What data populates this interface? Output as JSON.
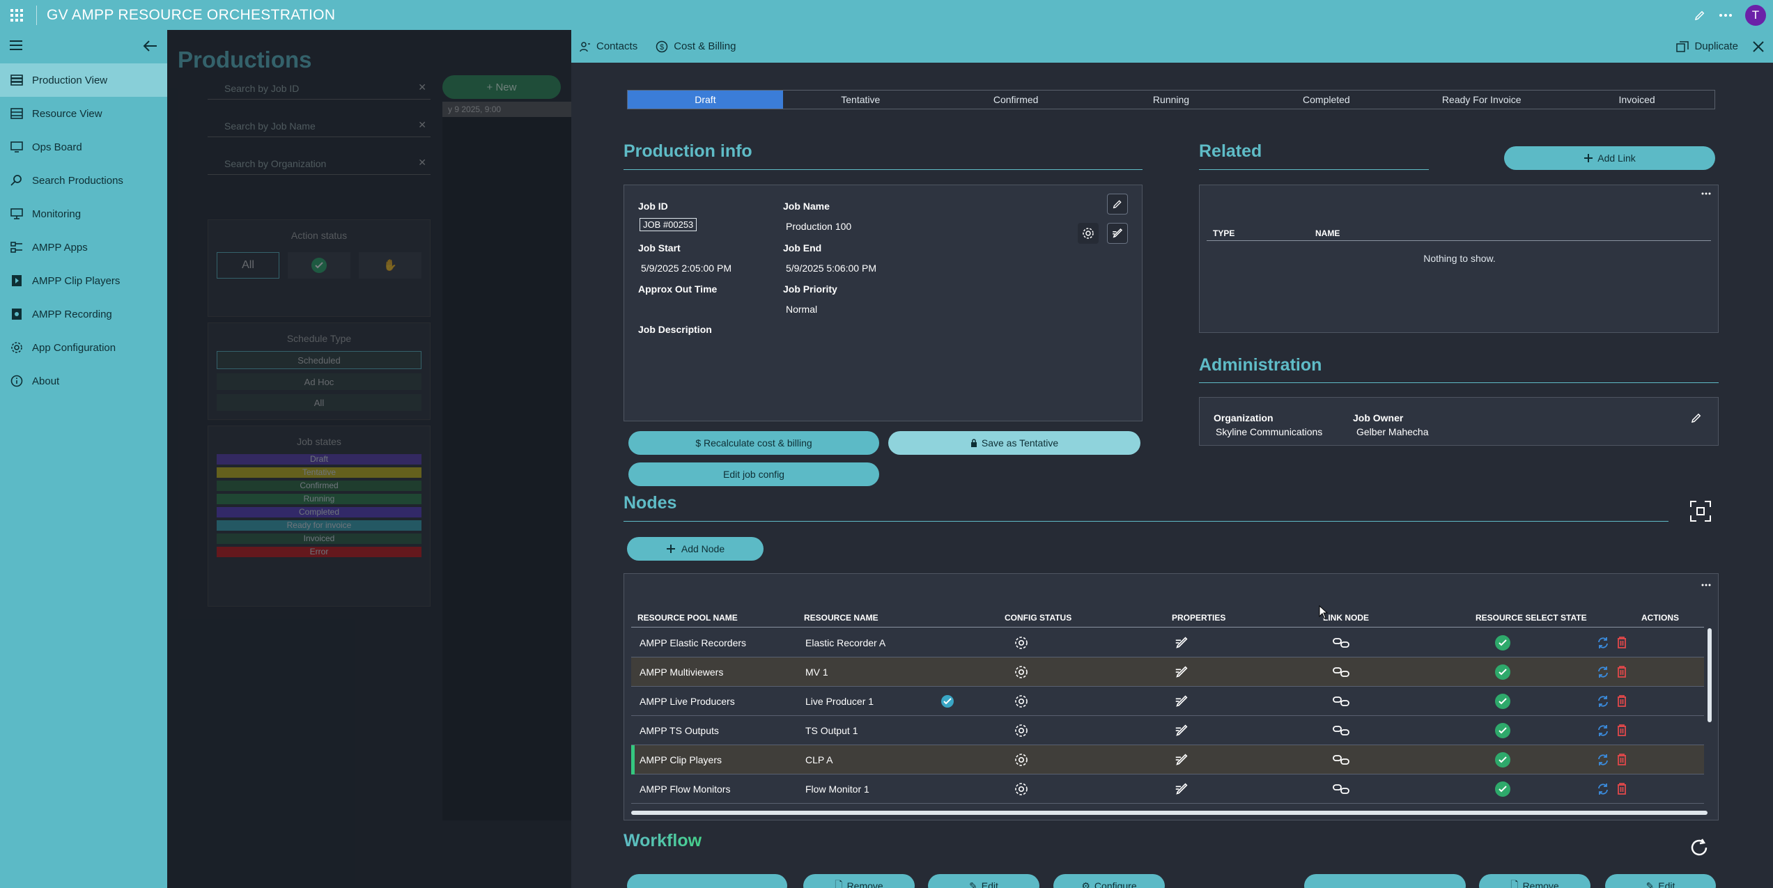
{
  "app": {
    "title": "GV AMPP RESOURCE ORCHESTRATION",
    "user_initial": "T"
  },
  "sidebar": {
    "items": [
      {
        "label": "Production View",
        "icon": "production-view-icon"
      },
      {
        "label": "Resource View",
        "icon": "resource-view-icon"
      },
      {
        "label": "Ops Board",
        "icon": "ops-board-icon"
      },
      {
        "label": "Search Productions",
        "icon": "search-icon"
      },
      {
        "label": "Monitoring",
        "icon": "monitor-icon"
      },
      {
        "label": "AMPP Apps",
        "icon": "apps-icon"
      },
      {
        "label": "AMPP Clip Players",
        "icon": "clip-player-icon"
      },
      {
        "label": "AMPP Recording",
        "icon": "recording-icon"
      },
      {
        "label": "App Configuration",
        "icon": "gear-icon"
      },
      {
        "label": "About",
        "icon": "info-icon"
      }
    ]
  },
  "background_page": {
    "title": "Productions",
    "new_label": "New",
    "search_job_id": "Search by Job ID",
    "search_job_name": "Search by Job Name",
    "search_org": "Search by Organization",
    "action_status": "Action status",
    "all_label": "All",
    "schedule_type": "Schedule Type",
    "scheduled": "Scheduled",
    "ad_hoc": "Ad Hoc",
    "all2": "All",
    "job_states": "Job states",
    "states": [
      {
        "label": "Draft",
        "color": "#5b3fb0"
      },
      {
        "label": "Tentative",
        "color": "#c9b81a"
      },
      {
        "label": "Confirmed",
        "color": "#2f6b3f"
      },
      {
        "label": "Running",
        "color": "#2f7f4a"
      },
      {
        "label": "Completed",
        "color": "#5a3fbf"
      },
      {
        "label": "Ready for invoice",
        "color": "#3aa6b5"
      },
      {
        "label": "Invoiced",
        "color": "#2f5f45"
      },
      {
        "label": "Error",
        "color": "#c81a1a"
      }
    ],
    "timeline_label": "y 9 2025, 9:00"
  },
  "detail": {
    "toolbar": {
      "contacts": "Contacts",
      "cost_billing": "Cost & Billing",
      "duplicate": "Duplicate"
    },
    "stepper": [
      "Draft",
      "Tentative",
      "Confirmed",
      "Running",
      "Completed",
      "Ready For Invoice",
      "Invoiced"
    ],
    "production_info": {
      "heading": "Production info",
      "job_id_label": "Job ID",
      "job_id": "JOB #00253",
      "job_name_label": "Job Name",
      "job_name": "Production 100",
      "job_start_label": "Job Start",
      "job_start": "5/9/2025 2:05:00 PM",
      "job_end_label": "Job End",
      "job_end": "5/9/2025 5:06:00 PM",
      "approx_out_label": "Approx Out Time",
      "priority_label": "Job Priority",
      "priority": "Normal",
      "description_label": "Job Description",
      "recalc_label": "$ Recalculate cost & billing",
      "save_tentative_label": "Save as Tentative",
      "edit_config_label": "Edit job config"
    },
    "related": {
      "heading": "Related",
      "add_link": "Add Link",
      "col_type": "TYPE",
      "col_name": "NAME",
      "empty": "Nothing to show."
    },
    "administration": {
      "heading": "Administration",
      "org_label": "Organization",
      "org": "Skyline Communications",
      "owner_label": "Job Owner",
      "owner": "Gelber Mahecha"
    },
    "nodes": {
      "heading": "Nodes",
      "add_node": "Add Node",
      "columns": [
        "RESOURCE POOL NAME",
        "RESOURCE NAME",
        "CONFIG STATUS",
        "PROPERTIES",
        "LINK NODE",
        "RESOURCE SELECT STATE",
        "ACTIONS"
      ],
      "rows": [
        {
          "pool": "AMPP Elastic Recorders",
          "name": "Elastic Recorder A"
        },
        {
          "pool": "AMPP Multiviewers",
          "name": "MV 1"
        },
        {
          "pool": "AMPP Live Producers",
          "name": "Live Producer 1"
        },
        {
          "pool": "AMPP TS Outputs",
          "name": "TS Output 1"
        },
        {
          "pool": "AMPP Clip Players",
          "name": "CLP A"
        },
        {
          "pool": "AMPP Flow Monitors",
          "name": "Flow Monitor 1"
        }
      ]
    },
    "workflow": {
      "heading": "Workflow",
      "remove": "Remove",
      "edit": "Edit",
      "configure": "Configure"
    }
  },
  "colors": {
    "accent": "#5cbac6",
    "active_step": "#3b7dd8",
    "ok": "#2ea96b",
    "delete": "#e0484a",
    "link_blue": "#3b8de0"
  }
}
